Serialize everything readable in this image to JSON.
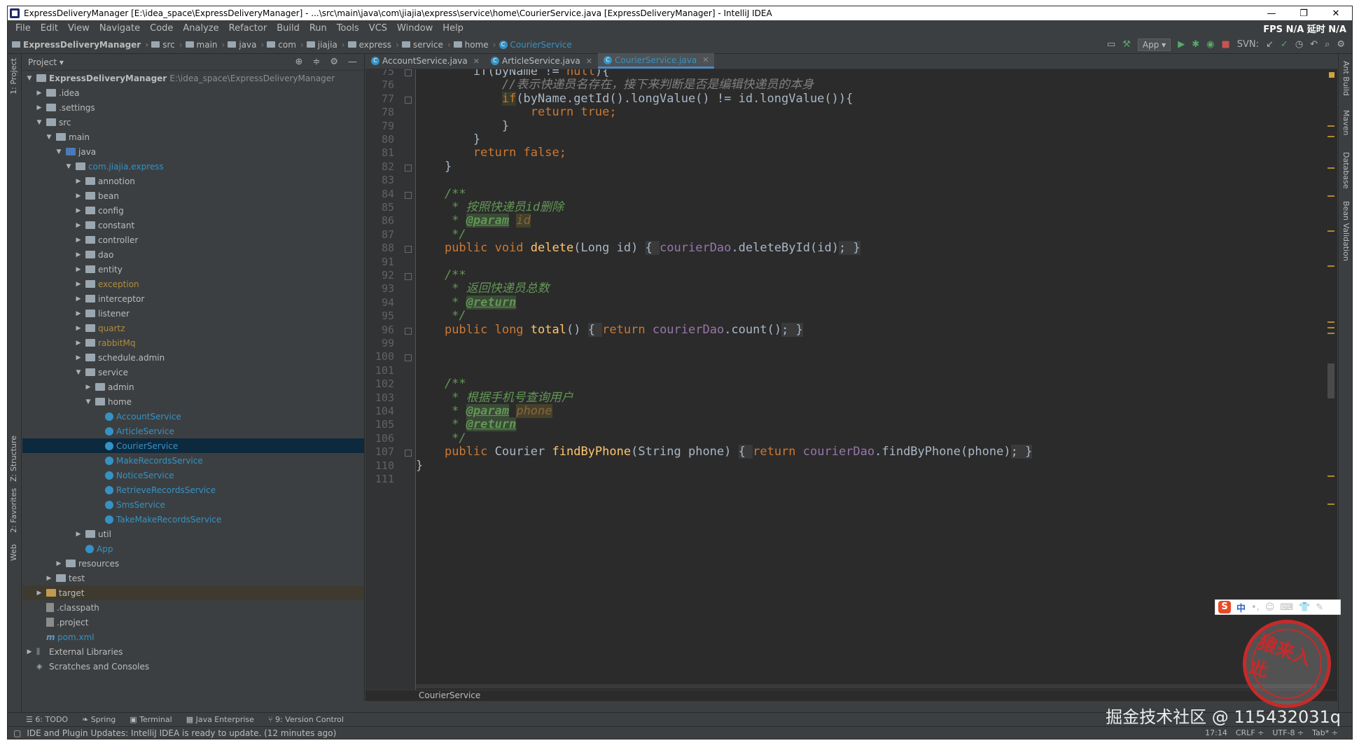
{
  "window": {
    "title": "ExpressDeliveryManager [E:\\idea_space\\ExpressDeliveryManager] - ...\\src\\main\\java\\com\\jiajia\\express\\service\\home\\CourierService.java [ExpressDeliveryManager] - IntelliJ IDEA",
    "minimize": "—",
    "maximize": "❐",
    "close": "✕"
  },
  "menu": {
    "items": [
      "File",
      "Edit",
      "View",
      "Navigate",
      "Code",
      "Analyze",
      "Refactor",
      "Build",
      "Run",
      "Tools",
      "VCS",
      "Window",
      "Help"
    ],
    "fps": "FPS  N/A  延时  N/A"
  },
  "nav": {
    "crumbs": [
      "ExpressDeliveryManager",
      "src",
      "main",
      "java",
      "com",
      "jiajia",
      "express",
      "service",
      "home",
      "CourierService"
    ],
    "run_config": "App",
    "svn": "SVN:"
  },
  "left_strip": {
    "project": "1: Project",
    "structure": "Z: Structure",
    "favorites": "2: Favorites",
    "web": "Web"
  },
  "right_strip": {
    "ant": "Ant Build",
    "maven": "Maven",
    "database": "Database",
    "bean": "Bean Validation"
  },
  "project": {
    "header": "Project",
    "root_name": "ExpressDeliveryManager",
    "root_path": "E:\\idea_space\\ExpressDeliveryManager",
    "items": {
      "idea": ".idea",
      "settings": ".settings",
      "src": "src",
      "main": "main",
      "java": "java",
      "pkg": "com.jiajia.express",
      "annotion": "annotion",
      "bean": "bean",
      "config": "config",
      "constant": "constant",
      "controller": "controller",
      "dao": "dao",
      "entity": "entity",
      "exception": "exception",
      "interceptor": "interceptor",
      "listener": "listener",
      "quartz": "quartz",
      "rabbitmq": "rabbitMq",
      "schedule": "schedule.admin",
      "service": "service",
      "admin": "admin",
      "home": "home",
      "c1": "AccountService",
      "c2": "ArticleService",
      "c3": "CourierService",
      "c4": "MakeRecordsService",
      "c5": "NoticeService",
      "c6": "RetrieveRecordsService",
      "c7": "SmsService",
      "c8": "TakeMakeRecordsService",
      "util": "util",
      "app": "App",
      "resources": "resources",
      "test": "test",
      "target": "target",
      "classpath": ".classpath",
      "projectfile": ".project",
      "pom": "pom.xml",
      "libs": "External Libraries",
      "scratches": "Scratches and Consoles"
    }
  },
  "tabs": [
    "AccountService.java",
    "ArticleService.java",
    "CourierService.java"
  ],
  "editor": {
    "line_numbers": [
      "75",
      "76",
      "77",
      "78",
      "79",
      "80",
      "81",
      "82",
      "83",
      "84",
      "85",
      "86",
      "87",
      "88",
      "91",
      "92",
      "93",
      "94",
      "95",
      "96",
      "99",
      "100",
      "101",
      "102",
      "103",
      "104",
      "105",
      "106",
      "107",
      "110",
      "111"
    ],
    "l75a": "        if(byName != ",
    "l75b": "null",
    "l75c": "){",
    "l76": "            //表示快递员名存在，接下来判断是否是编辑快递员的本身",
    "l77a": "            ",
    "l77b": "if",
    "l77c": "(byName.getId().longValue() != id.longValue()){",
    "l78a": "                ",
    "l78b": "return true",
    "l78c": ";",
    "l79": "            }",
    "l80": "        }",
    "l81a": "        ",
    "l81b": "return false",
    "l81c": ";",
    "l82": "    }",
    "l84": "    /**",
    "l85a": "     * ",
    "l85b": "按照快递员id删除",
    "l86a": "     * ",
    "l86b": "@param",
    "l86c": " ",
    "l86d": "id",
    "l87": "     */",
    "l88a": "    ",
    "l88b": "public void ",
    "l88c": "delete",
    "l88d": "(Long id) ",
    "l88e": "{ ",
    "l88f": "courierDao",
    "l88g": ".deleteById(id)",
    "l88h": "; }",
    "l92": "    /**",
    "l93a": "     * ",
    "l93b": "返回快递员总数",
    "l94a": "     * ",
    "l94b": "@return",
    "l95": "     */",
    "l96a": "    ",
    "l96b": "public long ",
    "l96c": "total",
    "l96d": "() ",
    "l96e": "{ ",
    "l96f": "return ",
    "l96g": "courierDao",
    "l96h": ".count()",
    "l96i": "; }",
    "l102": "    /**",
    "l103a": "     * ",
    "l103b": "根据手机号查询用户",
    "l104a": "     * ",
    "l104b": "@param",
    "l104c": " ",
    "l104d": "phone",
    "l105a": "     * ",
    "l105b": "@return",
    "l106": "     */",
    "l107a": "    ",
    "l107b": "public ",
    "l107c": "Courier ",
    "l107d": "findByPhone",
    "l107e": "(String phone) ",
    "l107f": "{ ",
    "l107g": "return ",
    "l107h": "courierDao",
    "l107i": ".findByPhone(phone)",
    "l107j": "; }",
    "l110": "}",
    "breadcrumb": "CourierService"
  },
  "bottom_tools": [
    "6: TODO",
    "Spring",
    "Terminal",
    "Java Enterprise",
    "9: Version Control"
  ],
  "status": {
    "message": "IDE and Plugin Updates: IntelliJ IDEA is ready to update. (12 minutes ago)",
    "position": "17:14",
    "line_sep": "CRLF ÷",
    "encoding": "UTF-8 ÷",
    "indent": "Tab* ÷"
  },
  "overlay": {
    "watermark": "掘金技术社区 @ 115432031q",
    "stamp": "猿来入此",
    "ime": "中"
  }
}
